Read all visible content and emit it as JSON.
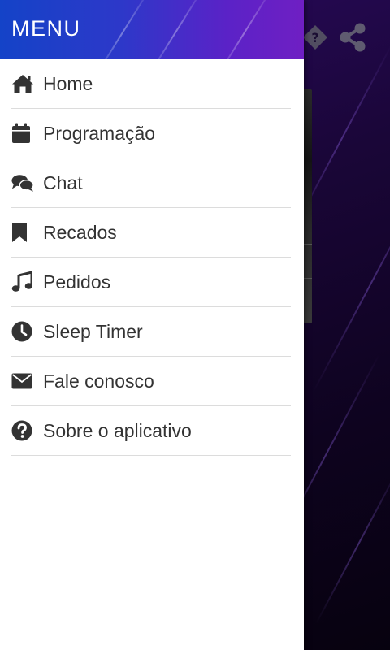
{
  "drawer": {
    "title": "MENU",
    "items": [
      {
        "label": "Home",
        "icon": "home-icon"
      },
      {
        "label": "Programação",
        "icon": "calendar-icon"
      },
      {
        "label": "Chat",
        "icon": "chat-icon"
      },
      {
        "label": "Recados",
        "icon": "bookmark-icon"
      },
      {
        "label": "Pedidos",
        "icon": "music-icon"
      },
      {
        "label": "Sleep Timer",
        "icon": "clock-icon"
      },
      {
        "label": "Fale conosco",
        "icon": "envelope-icon"
      },
      {
        "label": "Sobre o aplicativo",
        "icon": "question-circle-icon"
      }
    ]
  },
  "background_app": {
    "header_icons": [
      "help-icon",
      "share-icon"
    ]
  },
  "colors": {
    "drawer_header_start": "#1443c8",
    "drawer_header_end": "#6f1fc3",
    "menu_text": "#333333",
    "divider": "#dcdcdc",
    "background_dark": "#1a0638"
  }
}
